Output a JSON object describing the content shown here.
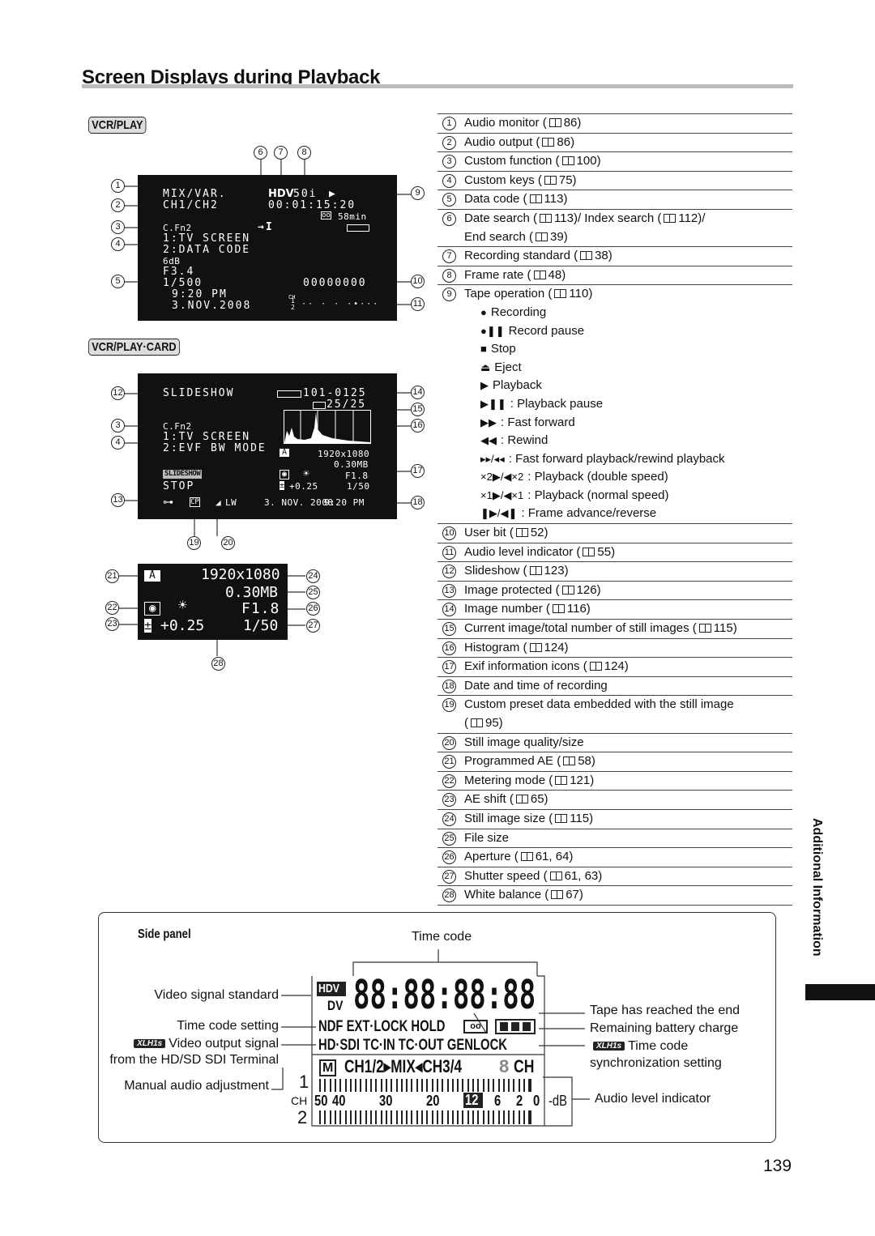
{
  "page": {
    "title": "Screen Displays during Playback",
    "number": "139",
    "side_tab": "Additional Information"
  },
  "modes": {
    "vcr_play": "VCR/PLAY",
    "vcr_play_card": "VCR/PLAY·CARD"
  },
  "screen1": {
    "mix": "MIX/VAR.",
    "ch": "CH1/CH2",
    "cfn": "C.Fn2",
    "key1": "1:TV SCREEN",
    "key2": "2:DATA CODE",
    "gain": "6dB",
    "aperture": "F3.4",
    "shutter": "1/500",
    "time": "9:20 PM",
    "date": "3.NOV.2008",
    "std": "HDV",
    "rate": "50i",
    "timecode": "00:01:15:20",
    "remaining": "58min",
    "date_search": "→I",
    "userbit": "00000000",
    "ch_label": "CH",
    "ch1": "1",
    "ch2": "2",
    "level": "·· · · ·•···"
  },
  "screen2": {
    "slideshow": "SLIDESHOW",
    "image_no": "101-0125",
    "count": "25/25",
    "cfn": "C.Fn2",
    "key1": "1:TV SCREEN",
    "key2": "2:EVF BW MODE",
    "size": "1920x1080",
    "filesize": "0.30MB",
    "aperture": "F1.8",
    "shutter": "1/50",
    "badge": "SLIDESHOW",
    "stop": "STOP",
    "ae_shift": "+0.25",
    "cp": "CP",
    "quality": "LW",
    "date": "3. NOV. 2008",
    "time": "9:20 PM"
  },
  "screen3": {
    "size": "1920x1080",
    "filesize": "0.30MB",
    "aperture": "F1.8",
    "ae_shift": "+0.25",
    "shutter": "1/50"
  },
  "items": [
    {
      "n": "1",
      "text": "Audio monitor (",
      "ref": "86)"
    },
    {
      "n": "2",
      "text": "Audio output (",
      "ref": "86)"
    },
    {
      "n": "3",
      "text": "Custom function (",
      "ref": "100)"
    },
    {
      "n": "4",
      "text": "Custom keys (",
      "ref": "75)"
    },
    {
      "n": "5",
      "text": "Data code (",
      "ref": "113)"
    },
    {
      "n": "6",
      "text": "Date search (",
      "ref": "113)/ Index search (",
      "ref2": "112)/",
      "line2": "End search (",
      "ref3": "39)"
    },
    {
      "n": "7",
      "text": "Recording standard (",
      "ref": "38)"
    },
    {
      "n": "8",
      "text": "Frame rate (",
      "ref": "48)"
    },
    {
      "n": "9",
      "text": "Tape operation (",
      "ref": "110)"
    },
    {
      "n": "10",
      "text": "User bit (",
      "ref": "52)"
    },
    {
      "n": "11",
      "text": "Audio level indicator (",
      "ref": "55)"
    },
    {
      "n": "12",
      "text": "Slideshow (",
      "ref": "123)"
    },
    {
      "n": "13",
      "text": "Image protected (",
      "ref": "126)"
    },
    {
      "n": "14",
      "text": "Image number (",
      "ref": "116)"
    },
    {
      "n": "15",
      "text": "Current image/total number of still images (",
      "ref": "115)"
    },
    {
      "n": "16",
      "text": "Histogram (",
      "ref": "124)"
    },
    {
      "n": "17",
      "text": "Exif information icons (",
      "ref": "124)"
    },
    {
      "n": "18",
      "text": "Date and time of recording"
    },
    {
      "n": "19",
      "text": "Custom preset data embedded with the still image",
      "line2": "(",
      "ref3": "95)"
    },
    {
      "n": "20",
      "text": "Still image quality/size"
    },
    {
      "n": "21",
      "text": "Programmed AE (",
      "ref": "58)"
    },
    {
      "n": "22",
      "text": "Metering mode (",
      "ref": "121)"
    },
    {
      "n": "23",
      "text": "AE shift (",
      "ref": "65)"
    },
    {
      "n": "24",
      "text": "Still image size (",
      "ref": "115)"
    },
    {
      "n": "25",
      "text": "File size"
    },
    {
      "n": "26",
      "text": "Aperture (",
      "ref": "61, 64)"
    },
    {
      "n": "27",
      "text": "Shutter speed (",
      "ref": "61, 63)"
    },
    {
      "n": "28",
      "text": "White balance (",
      "ref": "67)"
    }
  ],
  "tape_ops": [
    {
      "sym": "●",
      "label": "Recording"
    },
    {
      "sym": "●❚❚",
      "label": "Record pause"
    },
    {
      "sym": "■",
      "label": "Stop"
    },
    {
      "sym": "⏏",
      "label": "Eject"
    },
    {
      "sym": "▶",
      "label": "Playback"
    },
    {
      "sym": "▶❚❚",
      "label": ": Playback pause"
    },
    {
      "sym": "▶▶",
      "label": ": Fast forward"
    },
    {
      "sym": "◀◀",
      "label": ": Rewind"
    },
    {
      "sym": "▸▸/◂◂",
      "label": ": Fast forward playback/rewind playback"
    },
    {
      "sym": "×2▶/◀×2",
      "label": ": Playback (double speed)"
    },
    {
      "sym": "×1▶/◀×1",
      "label": ": Playback (normal speed)"
    },
    {
      "sym": "❚▶/◀❚",
      "label": ": Frame advance/reverse"
    }
  ],
  "side_panel": {
    "heading": "Side panel",
    "time_code": "Time code",
    "video_std": "Video signal standard",
    "tc_setting": "Time code setting",
    "xl_badge": "XLH1s",
    "video_out1": "Video output signal",
    "video_out2": "from the HD/SD SDI Terminal",
    "manual_audio": "Manual audio adjustment",
    "tape_end": "Tape has reached the end",
    "battery": "Remaining battery charge",
    "tc_sync1": "Time code",
    "tc_sync2": "synchronization setting",
    "audio_level": "Audio level indicator",
    "lcd": {
      "hdv": "HDV",
      "dv": "DV",
      "digits": "88:88:88:88",
      "row1": "NDF EXT·LOCK HOLD",
      "row2": "HD·SDI  TC·IN  TC·OUT  GENLOCK",
      "m": "M",
      "audio_mode": "CH1/2▸MIX◂CH3/4",
      "ch8": "8",
      "ch8b": "CH",
      "one": "1",
      "two": "2",
      "ch": "CH",
      "scale": [
        "50",
        "40",
        "30",
        "20",
        "12",
        "6",
        "2",
        "0"
      ],
      "db": "-dB"
    }
  }
}
